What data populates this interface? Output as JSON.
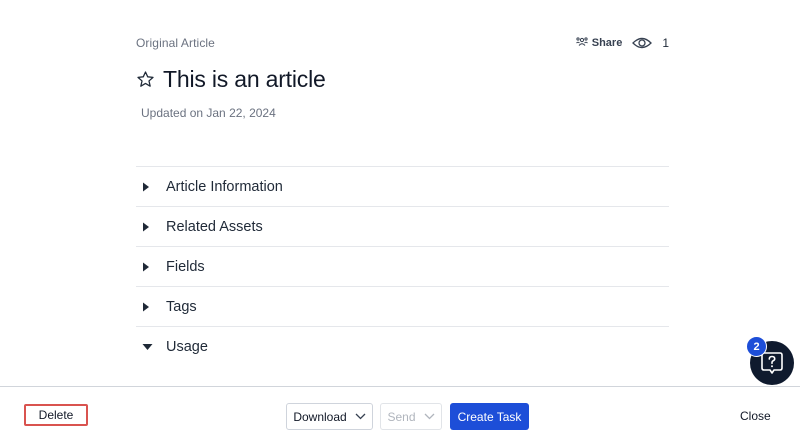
{
  "header": {
    "eyebrow": "Original Article",
    "share_label": "Share",
    "view_count": "1"
  },
  "article": {
    "title": "This is an article",
    "updated": "Updated on Jan 22, 2024"
  },
  "sections": [
    {
      "label": "Article Information",
      "expanded": false
    },
    {
      "label": "Related Assets",
      "expanded": false
    },
    {
      "label": "Fields",
      "expanded": false
    },
    {
      "label": "Tags",
      "expanded": false
    },
    {
      "label": "Usage",
      "expanded": true
    }
  ],
  "help": {
    "badge_count": "2",
    "icon": "question-icon"
  },
  "footer": {
    "delete_label": "Delete",
    "download_label": "Download",
    "send_label": "Send",
    "create_task_label": "Create Task",
    "close_label": "Close"
  },
  "colors": {
    "primary": "#1d4ed8",
    "help_fab": "#0f1a2e",
    "delete_outline": "#d9534f"
  }
}
